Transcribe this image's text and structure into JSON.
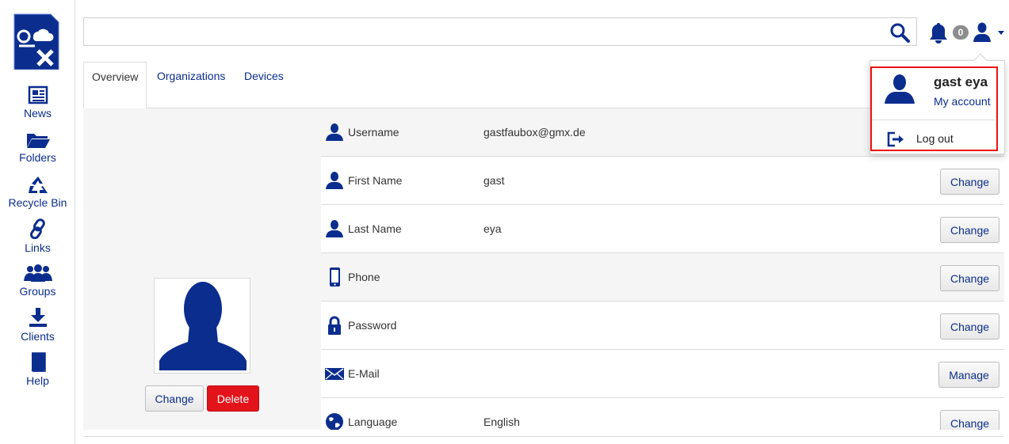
{
  "sidebar": {
    "items": [
      {
        "label": "News",
        "icon": "newspaper-icon"
      },
      {
        "label": "Folders",
        "icon": "folder-icon"
      },
      {
        "label": "Recycle Bin",
        "icon": "recycle-icon"
      },
      {
        "label": "Links",
        "icon": "link-icon"
      },
      {
        "label": "Groups",
        "icon": "group-icon"
      },
      {
        "label": "Clients",
        "icon": "download-icon"
      },
      {
        "label": "Help",
        "icon": "book-icon"
      }
    ]
  },
  "header": {
    "search_value": "",
    "notification_count": "0"
  },
  "tabs": [
    {
      "label": "Overview",
      "active": true
    },
    {
      "label": "Organizations",
      "active": false
    },
    {
      "label": "Devices",
      "active": false
    }
  ],
  "avatar": {
    "change_label": "Change",
    "delete_label": "Delete"
  },
  "rows": [
    {
      "label": "Username",
      "value": "gastfaubox@gmx.de",
      "button": "",
      "icon": "user-icon"
    },
    {
      "label": "First Name",
      "value": "gast",
      "button": "Change",
      "icon": "user-icon"
    },
    {
      "label": "Last Name",
      "value": "eya",
      "button": "Change",
      "icon": "user-icon"
    },
    {
      "label": "Phone",
      "value": "",
      "button": "Change",
      "icon": "phone-icon"
    },
    {
      "label": "Password",
      "value": "",
      "button": "Change",
      "icon": "lock-icon"
    },
    {
      "label": "E-Mail",
      "value": "",
      "button": "Manage",
      "icon": "envelope-icon"
    },
    {
      "label": "Language",
      "value": "English",
      "button": "Change",
      "icon": "globe-icon"
    }
  ],
  "dropdown": {
    "user_name": "gast eya",
    "my_account": "My account",
    "logout": "Log out"
  },
  "colors": {
    "brand_blue": "#0b2d8e",
    "danger_red": "#e3131a",
    "highlight_red": "#ee1111"
  }
}
